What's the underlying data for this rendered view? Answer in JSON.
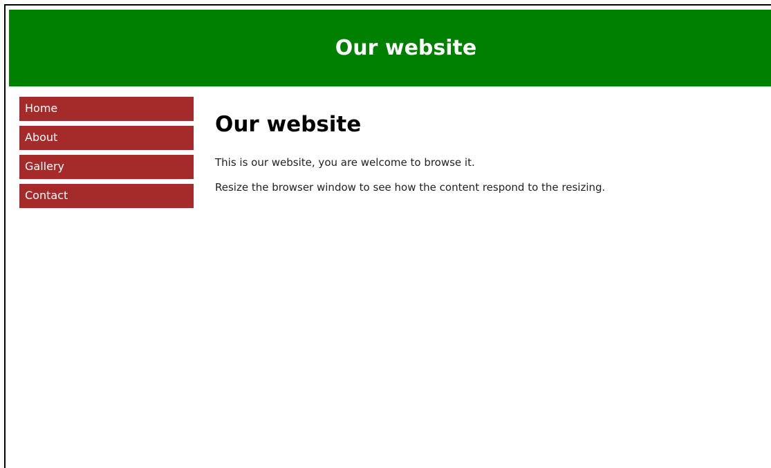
{
  "header": {
    "title": "Our website"
  },
  "nav": {
    "items": [
      {
        "label": "Home"
      },
      {
        "label": "About"
      },
      {
        "label": "Gallery"
      },
      {
        "label": "Contact"
      }
    ]
  },
  "main": {
    "heading": "Our website",
    "paragraphs": [
      "This is our website, you are welcome to browse it.",
      "Resize the browser window to see how the content respond to the resizing."
    ]
  },
  "colors": {
    "header_bg": "#008000",
    "nav_item_bg": "#a52a2a",
    "text": "#000000"
  }
}
